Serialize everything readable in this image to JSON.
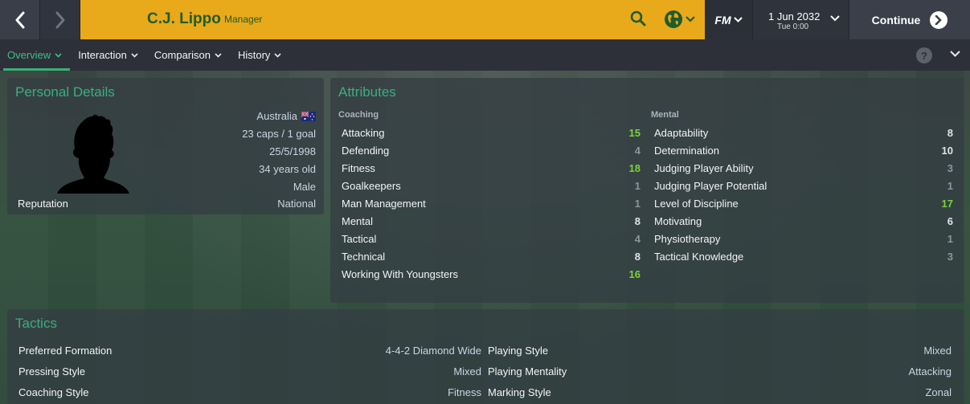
{
  "header": {
    "manager_name": "C.J. Lippo",
    "role": "Manager",
    "fm_label": "FM",
    "date": "1 Jun 2032",
    "time": "Tue 0:00",
    "continue_label": "Continue",
    "accent_color": "#e8a91a",
    "name_color": "#1f5c2a"
  },
  "subnav": {
    "tabs": [
      {
        "label": "Overview",
        "active": true
      },
      {
        "label": "Interaction"
      },
      {
        "label": "Comparison"
      },
      {
        "label": "History"
      }
    ],
    "help_label": "?"
  },
  "personal": {
    "title": "Personal Details",
    "nationality": "Australia",
    "caps": "23 caps / 1 goal",
    "dob": "25/5/1998",
    "age": "34 years old",
    "gender": "Male",
    "reputation_label": "Reputation",
    "reputation_value": "National"
  },
  "attributes": {
    "title": "Attributes",
    "coaching_label": "Coaching",
    "mental_label": "Mental",
    "coaching": [
      {
        "name": "Attacking",
        "value": "15"
      },
      {
        "name": "Defending",
        "value": "4"
      },
      {
        "name": "Fitness",
        "value": "18"
      },
      {
        "name": "Goalkeepers",
        "value": "1"
      },
      {
        "name": "Man Management",
        "value": "1"
      },
      {
        "name": "Mental",
        "value": "8"
      },
      {
        "name": "Tactical",
        "value": "4"
      },
      {
        "name": "Technical",
        "value": "8"
      },
      {
        "name": "Working With Youngsters",
        "value": "16"
      }
    ],
    "mental": [
      {
        "name": "Adaptability",
        "value": "8"
      },
      {
        "name": "Determination",
        "value": "10"
      },
      {
        "name": "Judging Player Ability",
        "value": "3"
      },
      {
        "name": "Judging Player Potential",
        "value": "1"
      },
      {
        "name": "Level of Discipline",
        "value": "17"
      },
      {
        "name": "Motivating",
        "value": "6"
      },
      {
        "name": "Physiotherapy",
        "value": "1"
      },
      {
        "name": "Tactical Knowledge",
        "value": "3"
      }
    ]
  },
  "tactics": {
    "title": "Tactics",
    "rows": [
      [
        {
          "label": "Preferred Formation",
          "value": "4-4-2 Diamond Wide"
        },
        {
          "label": "Playing Style",
          "value": "Mixed"
        }
      ],
      [
        {
          "label": "Pressing Style",
          "value": "Mixed"
        },
        {
          "label": "Playing Mentality",
          "value": "Attacking"
        }
      ],
      [
        {
          "label": "Coaching Style",
          "value": "Fitness"
        },
        {
          "label": "Marking Style",
          "value": "Zonal"
        }
      ]
    ]
  }
}
